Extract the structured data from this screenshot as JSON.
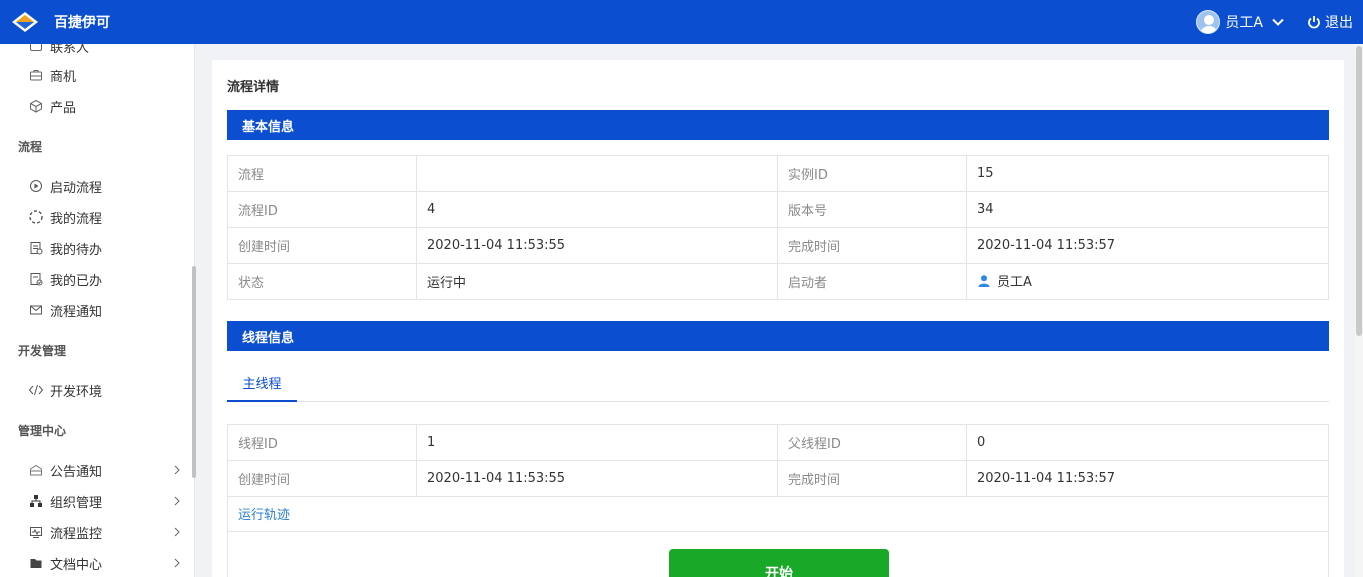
{
  "app": {
    "title": "百捷伊可"
  },
  "header": {
    "user_name": "员工A",
    "logout_label": "退出"
  },
  "sidebar": {
    "items_top": [
      {
        "label": "联系人",
        "icon": "contact-icon"
      },
      {
        "label": "商机",
        "icon": "briefcase-icon"
      },
      {
        "label": "产品",
        "icon": "cube-icon"
      }
    ],
    "group_flow": "流程",
    "items_flow": [
      {
        "label": "启动流程",
        "icon": "play-circle-icon"
      },
      {
        "label": "我的流程",
        "icon": "loading-circle-icon"
      },
      {
        "label": "我的待办",
        "icon": "todo-doc-icon"
      },
      {
        "label": "我的已办",
        "icon": "done-doc-icon"
      },
      {
        "label": "流程通知",
        "icon": "mail-icon"
      }
    ],
    "group_dev": "开发管理",
    "items_dev": [
      {
        "label": "开发环境",
        "icon": "code-icon"
      }
    ],
    "group_admin": "管理中心",
    "items_admin": [
      {
        "label": "公告通知",
        "icon": "announcement-icon"
      },
      {
        "label": "组织管理",
        "icon": "org-chart-icon"
      },
      {
        "label": "流程监控",
        "icon": "monitor-icon"
      },
      {
        "label": "文档中心",
        "icon": "folder-icon"
      }
    ]
  },
  "main": {
    "page_title": "流程详情",
    "basic_section_title": "基本信息",
    "basic": {
      "flow_label": "流程",
      "flow_value": "",
      "instance_id_label": "实例ID",
      "instance_id_value": "15",
      "flow_id_label": "流程ID",
      "flow_id_value": "4",
      "version_label": "版本号",
      "version_value": "34",
      "created_label": "创建时间",
      "created_value": "2020-11-04 11:53:55",
      "finished_label": "完成时间",
      "finished_value": "2020-11-04 11:53:57",
      "status_label": "状态",
      "status_value": "运行中",
      "starter_label": "启动者",
      "starter_value": "员工A"
    },
    "thread_section_title": "线程信息",
    "tabs": [
      {
        "label": "主线程",
        "active": true
      }
    ],
    "thread": {
      "thread_id_label": "线程ID",
      "thread_id_value": "1",
      "parent_id_label": "父线程ID",
      "parent_id_value": "0",
      "created_label": "创建时间",
      "created_value": "2020-11-04 11:53:55",
      "finished_label": "完成时间",
      "finished_value": "2020-11-04 11:53:57"
    },
    "trace_link": "运行轨迹",
    "start_node_label": "开始"
  },
  "colors": {
    "primary": "#0b4fd0",
    "start_node": "#1aa829",
    "link": "#2a7fd4"
  }
}
